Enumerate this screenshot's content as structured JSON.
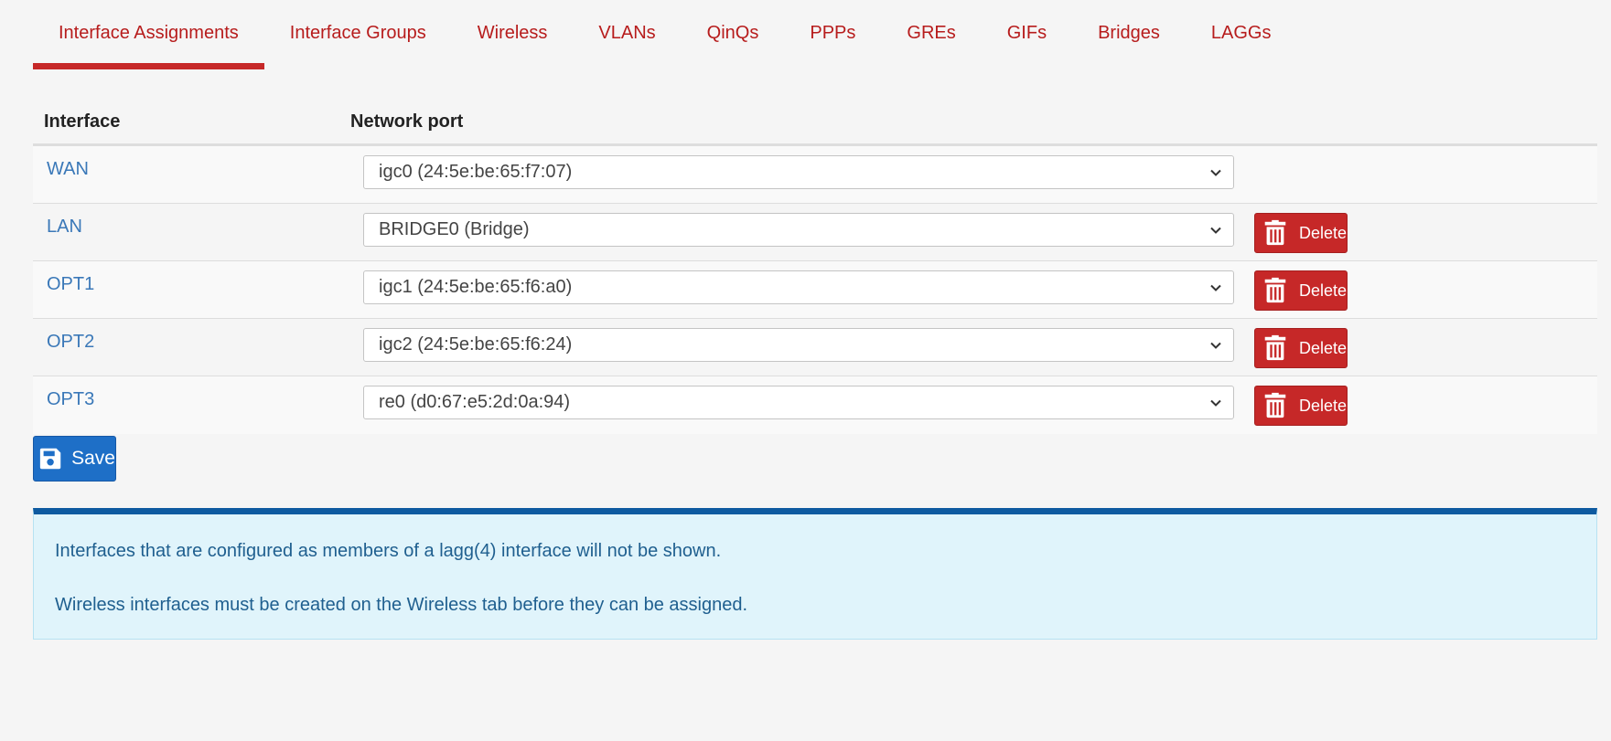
{
  "tabs": [
    {
      "label": "Interface Assignments",
      "active": true
    },
    {
      "label": "Interface Groups",
      "active": false
    },
    {
      "label": "Wireless",
      "active": false
    },
    {
      "label": "VLANs",
      "active": false
    },
    {
      "label": "QinQs",
      "active": false
    },
    {
      "label": "PPPs",
      "active": false
    },
    {
      "label": "GREs",
      "active": false
    },
    {
      "label": "GIFs",
      "active": false
    },
    {
      "label": "Bridges",
      "active": false
    },
    {
      "label": "LAGGs",
      "active": false
    }
  ],
  "table": {
    "headers": {
      "interface": "Interface",
      "port": "Network port"
    },
    "rows": [
      {
        "interface": "WAN",
        "port": "igc0 (24:5e:be:65:f7:07)",
        "deletable": false
      },
      {
        "interface": "LAN",
        "port": "BRIDGE0 (Bridge)",
        "deletable": true
      },
      {
        "interface": "OPT1",
        "port": "igc1 (24:5e:be:65:f6:a0)",
        "deletable": true
      },
      {
        "interface": "OPT2",
        "port": "igc2 (24:5e:be:65:f6:24)",
        "deletable": true
      },
      {
        "interface": "OPT3",
        "port": "re0 (d0:67:e5:2d:0a:94)",
        "deletable": true
      }
    ],
    "delete_label": "Delete"
  },
  "save_label": "Save",
  "info": {
    "line1": "Interfaces that are configured as members of a lagg(4) interface will not be shown.",
    "line2": "Wireless interfaces must be created on the Wireless tab before they can be assigned."
  },
  "icons": {
    "delete": "trash-icon",
    "save": "floppy-disk-icon",
    "dropdown": "chevron-down-icon"
  },
  "colors": {
    "accent_red": "#c62828",
    "link_blue": "#3a78b8",
    "save_blue": "#1e6fc7",
    "info_bg": "#e0f4fb",
    "info_border": "#0e5aa0"
  }
}
